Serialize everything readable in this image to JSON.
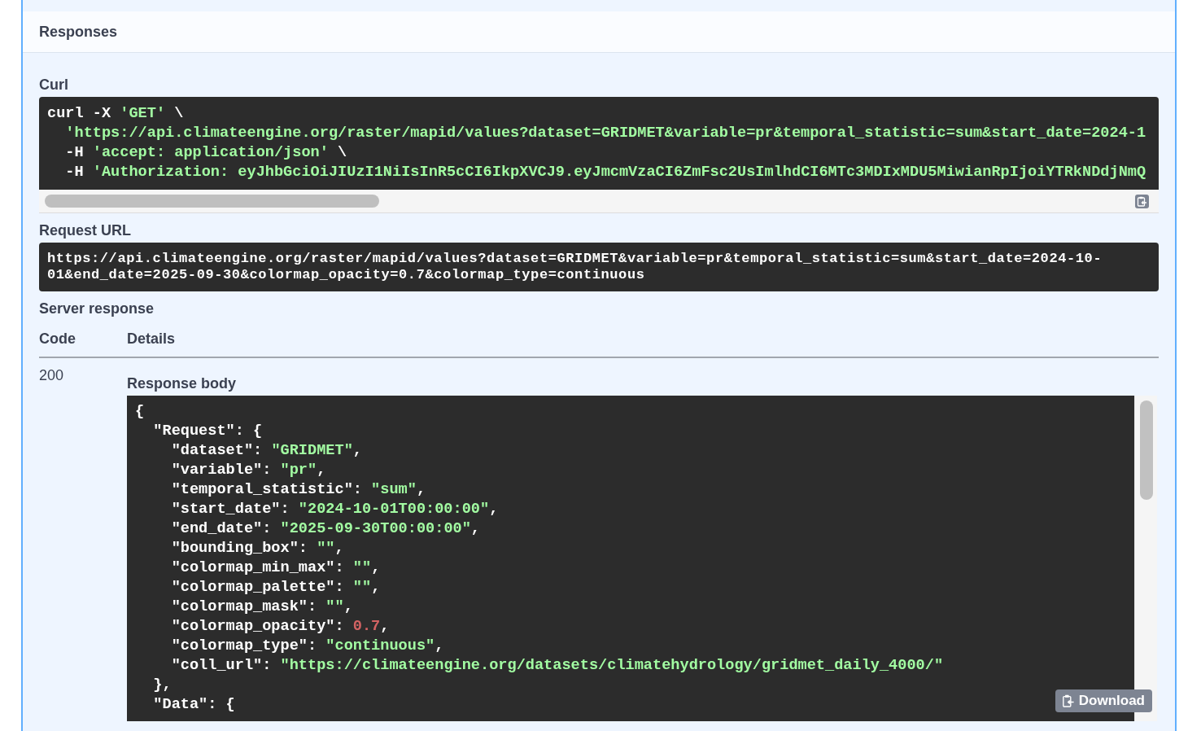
{
  "section": {
    "title": "Responses"
  },
  "curl": {
    "label": "Curl",
    "lines": [
      {
        "tokens": [
          {
            "kind": "plain",
            "text": "curl -X "
          },
          {
            "kind": "string",
            "text": "'GET'"
          },
          {
            "kind": "plain",
            "text": " \\"
          }
        ],
        "children": [
          {
            "tokens": [
              {
                "kind": "string",
                "text": "'https://api.climateengine.org/raster/mapid/values?dataset=GRIDMET&variable=pr&temporal_statistic=sum&start_date=2024-1"
              }
            ]
          },
          {
            "tokens": [
              {
                "kind": "plain",
                "text": "-H "
              },
              {
                "kind": "string",
                "text": "'accept: application/json'"
              },
              {
                "kind": "plain",
                "text": " \\"
              }
            ]
          },
          {
            "tokens": [
              {
                "kind": "plain",
                "text": "-H "
              },
              {
                "kind": "string",
                "text": "'Authorization: eyJhbGciOiJIUzI1NiIsInR5cCI6IkpXVCJ9.eyJmcmVzaCI6ZmFsc2UsImlhdCI6MTc3MDIxMDU5MiwianRpIjoiYTRkNDdjNmQ"
              }
            ]
          }
        ]
      }
    ]
  },
  "request_url": {
    "label": "Request URL",
    "value": "https://api.climateengine.org/raster/mapid/values?dataset=GRIDMET&variable=pr&temporal_statistic=sum&start_date=2024-10-01&end_date=2025-09-30&colormap_opacity=0.7&colormap_type=continuous"
  },
  "server_response": {
    "label": "Server response",
    "columns": [
      "Code",
      "Details"
    ],
    "rows": [
      {
        "code": "200",
        "details": {
          "label": "Response body",
          "download_button": "Download",
          "lines": [
            {
              "tokens": [
                {
                  "kind": "plain",
                  "text": "{"
                }
              ],
              "children": [
                {
                  "tokens": [
                    {
                      "kind": "plain",
                      "text": "\"Request\": {"
                    }
                  ],
                  "children": [
                    {
                      "tokens": [
                        {
                          "kind": "plain",
                          "text": "\"dataset\": "
                        },
                        {
                          "kind": "string",
                          "text": "\"GRIDMET\""
                        },
                        {
                          "kind": "plain",
                          "text": ","
                        }
                      ]
                    },
                    {
                      "tokens": [
                        {
                          "kind": "plain",
                          "text": "\"variable\": "
                        },
                        {
                          "kind": "string",
                          "text": "\"pr\""
                        },
                        {
                          "kind": "plain",
                          "text": ","
                        }
                      ]
                    },
                    {
                      "tokens": [
                        {
                          "kind": "plain",
                          "text": "\"temporal_statistic\": "
                        },
                        {
                          "kind": "string",
                          "text": "\"sum\""
                        },
                        {
                          "kind": "plain",
                          "text": ","
                        }
                      ]
                    },
                    {
                      "tokens": [
                        {
                          "kind": "plain",
                          "text": "\"start_date\": "
                        },
                        {
                          "kind": "string",
                          "text": "\"2024-10-01T00:00:00\""
                        },
                        {
                          "kind": "plain",
                          "text": ","
                        }
                      ]
                    },
                    {
                      "tokens": [
                        {
                          "kind": "plain",
                          "text": "\"end_date\": "
                        },
                        {
                          "kind": "string",
                          "text": "\"2025-09-30T00:00:00\""
                        },
                        {
                          "kind": "plain",
                          "text": ","
                        }
                      ]
                    },
                    {
                      "tokens": [
                        {
                          "kind": "plain",
                          "text": "\"bounding_box\": "
                        },
                        {
                          "kind": "string",
                          "text": "\"\""
                        },
                        {
                          "kind": "plain",
                          "text": ","
                        }
                      ]
                    },
                    {
                      "tokens": [
                        {
                          "kind": "plain",
                          "text": "\"colormap_min_max\": "
                        },
                        {
                          "kind": "string",
                          "text": "\"\""
                        },
                        {
                          "kind": "plain",
                          "text": ","
                        }
                      ]
                    },
                    {
                      "tokens": [
                        {
                          "kind": "plain",
                          "text": "\"colormap_palette\": "
                        },
                        {
                          "kind": "string",
                          "text": "\"\""
                        },
                        {
                          "kind": "plain",
                          "text": ","
                        }
                      ]
                    },
                    {
                      "tokens": [
                        {
                          "kind": "plain",
                          "text": "\"colormap_mask\": "
                        },
                        {
                          "kind": "string",
                          "text": "\"\""
                        },
                        {
                          "kind": "plain",
                          "text": ","
                        }
                      ]
                    },
                    {
                      "tokens": [
                        {
                          "kind": "plain",
                          "text": "\"colormap_opacity\": "
                        },
                        {
                          "kind": "number",
                          "text": "0.7"
                        },
                        {
                          "kind": "plain",
                          "text": ","
                        }
                      ]
                    },
                    {
                      "tokens": [
                        {
                          "kind": "plain",
                          "text": "\"colormap_type\": "
                        },
                        {
                          "kind": "string",
                          "text": "\"continuous\""
                        },
                        {
                          "kind": "plain",
                          "text": ","
                        }
                      ]
                    },
                    {
                      "tokens": [
                        {
                          "kind": "plain",
                          "text": "\"coll_url\": "
                        },
                        {
                          "kind": "string",
                          "text": "\"https://climateengine.org/datasets/climatehydrology/gridmet_daily_4000/\""
                        }
                      ]
                    }
                  ]
                },
                {
                  "tokens": [
                    {
                      "kind": "plain",
                      "text": "},"
                    }
                  ]
                },
                {
                  "tokens": [
                    {
                      "kind": "plain",
                      "text": "\"Data\": {"
                    }
                  ]
                }
              ]
            }
          ]
        }
      }
    ]
  }
}
